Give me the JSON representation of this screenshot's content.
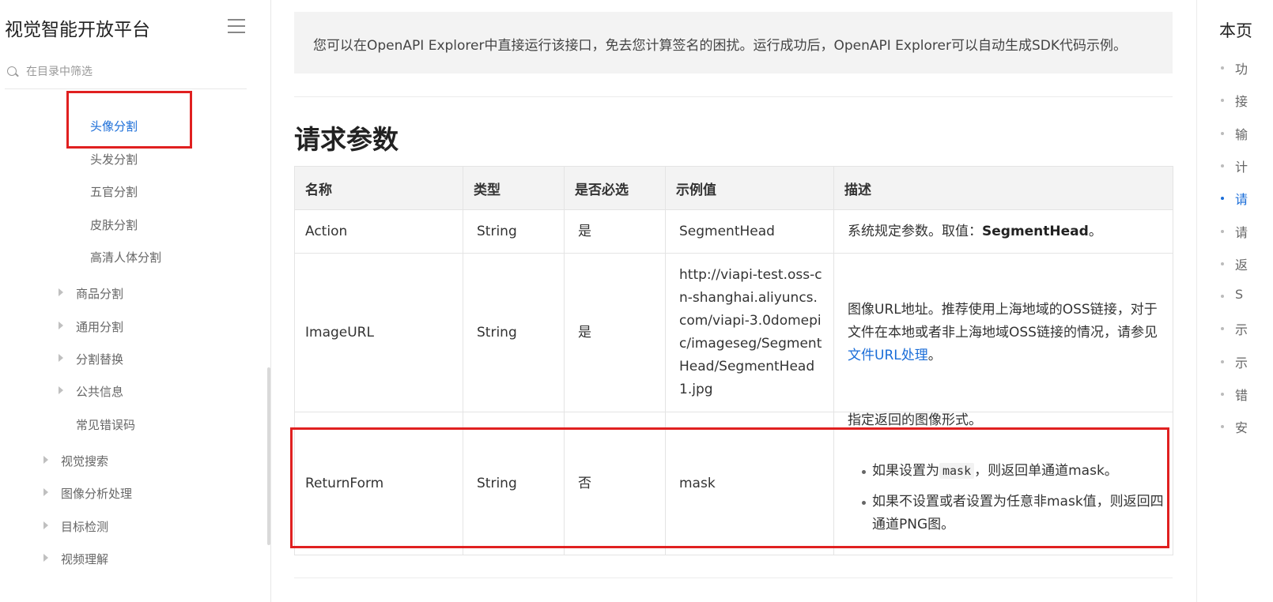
{
  "sidebar": {
    "title": "视觉智能开放平台",
    "filter_placeholder": "在目录中筛选",
    "items": [
      {
        "label": "头像分割"
      },
      {
        "label": "头发分割"
      },
      {
        "label": "五官分割"
      },
      {
        "label": "皮肤分割"
      },
      {
        "label": "高清人体分割"
      },
      {
        "label": "商品分割"
      },
      {
        "label": "通用分割"
      },
      {
        "label": "分割替换"
      },
      {
        "label": "公共信息"
      },
      {
        "label": "常见错误码"
      },
      {
        "label": "视觉搜索"
      },
      {
        "label": "图像分析处理"
      },
      {
        "label": "目标检测"
      },
      {
        "label": "视频理解"
      }
    ]
  },
  "main": {
    "info_text": "您可以在OpenAPI Explorer中直接运行该接口，免去您计算签名的困扰。运行成功后，OpenAPI Explorer可以自动生成SDK代码示例。",
    "section_title": "请求参数",
    "columns": [
      "名称",
      "类型",
      "是否必选",
      "示例值",
      "描述"
    ],
    "rows": [
      {
        "name": "Action",
        "type": "String",
        "required": "是",
        "example": "SegmentHead",
        "desc_prefix": "系统规定参数。取值：",
        "desc_bold": "SegmentHead",
        "desc_suffix": "。"
      },
      {
        "name": "ImageURL",
        "type": "String",
        "required": "是",
        "example": "http://viapi-test.oss-cn-shanghai.aliyuncs.com/viapi-3.0domepic/imageseg/SegmentHead/SegmentHead1.jpg",
        "desc_prefix": "图像URL地址。推荐使用上海地域的OSS链接，对于文件在本地或者非上海地域OSS链接的情况，请参见",
        "desc_link": "文件URL处理",
        "desc_suffix": "。"
      },
      {
        "name": "ReturnForm",
        "type": "String",
        "required": "否",
        "example": "mask",
        "desc_top": "指定返回的图像形式。",
        "bullet1_prefix": "如果设置为",
        "bullet1_code": "mask",
        "bullet1_suffix": "，则返回单通道mask。",
        "bullet2": "如果不设置或者设置为任意非mask值，则返回四通道PNG图。"
      }
    ]
  },
  "toc": {
    "title": "本页",
    "items": [
      "功",
      "接",
      "输",
      "计",
      "请",
      "请",
      "返",
      "S",
      "示",
      "示",
      "错",
      "安"
    ],
    "active_index": 4
  },
  "colors": {
    "accent": "#1a6dd8",
    "highlight": "#e02020"
  }
}
